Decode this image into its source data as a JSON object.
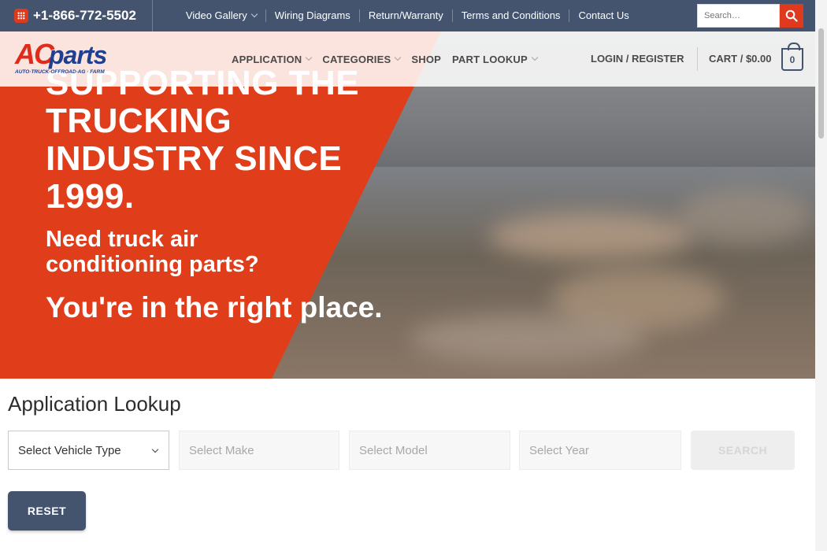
{
  "topbar": {
    "phone": "+1-866-772-5502",
    "links": [
      "Video Gallery",
      "Wiring Diagrams",
      "Return/Warranty",
      "Terms and Conditions",
      "Contact Us"
    ],
    "search_placeholder": "Search…"
  },
  "header": {
    "logo_text": "ACparts",
    "logo_tagline": "AUTO·TRUCK·OFFROAD·AG · FARM",
    "nav": [
      "APPLICATION",
      "CATEGORIES",
      "SHOP",
      "PART LOOKUP"
    ],
    "login": "LOGIN / REGISTER",
    "cart": "CART / $0.00",
    "cart_count": "0"
  },
  "hero": {
    "title": "SUPPORTING THE TRUCKING INDUSTRY SINCE 1999.",
    "subtitle": "Need truck air conditioning parts?",
    "tagline": "You're in the right place."
  },
  "lookup": {
    "title": "Application Lookup",
    "vehicle_type": "Select Vehicle Type",
    "make": "Select Make",
    "model": "Select Model",
    "year": "Select Year",
    "search": "SEARCH",
    "reset": "RESET"
  },
  "colors": {
    "topbar": "#44546f",
    "accent": "#e03e1a",
    "brand_blue": "#1f3f8f"
  }
}
